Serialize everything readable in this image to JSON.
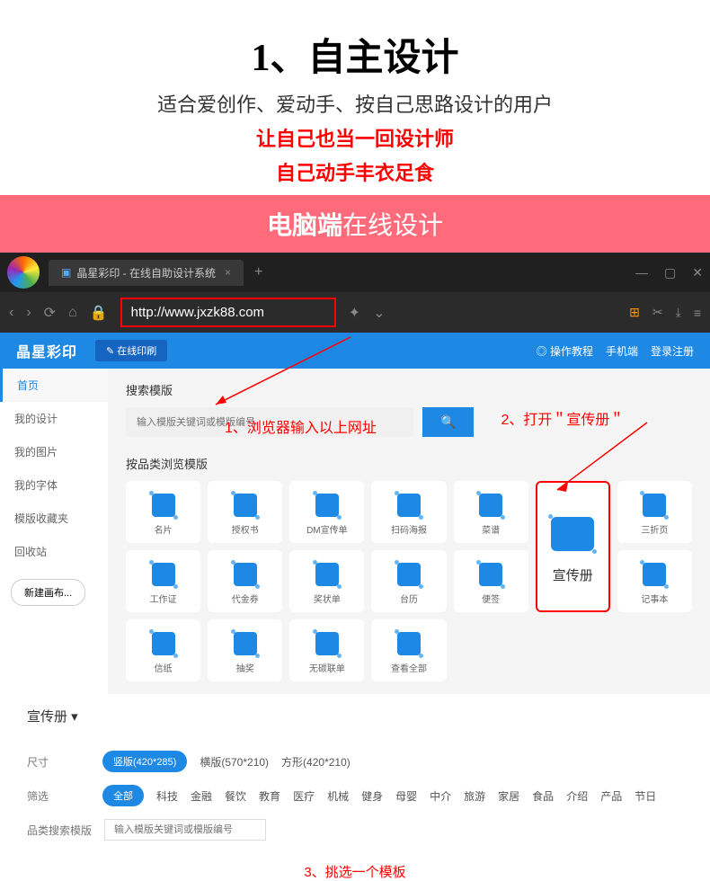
{
  "header": {
    "main_title": "1、自主设计",
    "subtitle": "适合爱创作、爱动手、按自己思路设计的用户",
    "red_line1": "让自己也当一回设计师",
    "red_line2": "自己动手丰衣足食"
  },
  "banner": {
    "bold": "电脑端",
    "normal": "在线设计"
  },
  "browser": {
    "tab_title": "晶星彩印 - 在线自助设计系统",
    "url": "http://www.jxzk88.com"
  },
  "app": {
    "logo": "晶星彩印",
    "nav_btn": "✎ 在线印刷",
    "right_links": [
      "◎ 操作教程",
      "手机端",
      "登录注册"
    ]
  },
  "sidebar": {
    "items": [
      "首页",
      "我的设计",
      "我的图片",
      "我的字体",
      "模版收藏夹",
      "回收站"
    ],
    "new_btn": "新建画布..."
  },
  "main": {
    "search_title": "搜索模版",
    "search_placeholder": "输入模版关键词或模版编号",
    "cat_title": "按品类浏览模版",
    "categories_row1": [
      "名片",
      "授权书",
      "DM宣传单",
      "扫码海报",
      "菜谱"
    ],
    "categories_row2": [
      "奖状单",
      "台历",
      "便签",
      "记事本",
      "信纸"
    ],
    "featured": "宣传册",
    "categories_right": [
      "三折页",
      "工作证",
      "代金券",
      "抽奖",
      "无碳联单",
      "查看全部"
    ]
  },
  "annotations": {
    "a1": "1、浏览器输入以上网址",
    "a2": "2、打开＂宣传册＂",
    "a3": "3、挑选一个模板"
  },
  "crumb": "宣传册 ▾",
  "filters": {
    "size_label": "尺寸",
    "size_active": "竖版(420*285)",
    "size_opts": [
      "横版(570*210)",
      "方形(420*210)"
    ],
    "scene_label": "筛选",
    "scene_active": "全部",
    "scene_opts": [
      "科技",
      "金融",
      "餐饮",
      "教育",
      "医疗",
      "机械",
      "健身",
      "母婴",
      "中介",
      "旅游",
      "家居",
      "食品",
      "介绍",
      "产品",
      "节日"
    ],
    "search_label": "品类搜索模版",
    "search_placeholder": "输入模版关键词或模版编号"
  }
}
